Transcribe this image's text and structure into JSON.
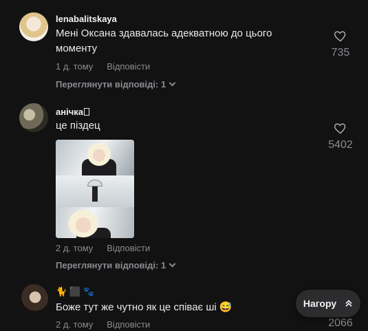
{
  "comments": [
    {
      "username": "lenabalitskaya",
      "text": "Мені Оксана здавалась адекватною до цього моменту",
      "time": "1 д. тому",
      "reply": "Відповісти",
      "likes": "735",
      "view_replies": "Переглянути відповіді: 1"
    },
    {
      "username": "анічка",
      "username_suffix": "",
      "text": "це піздец",
      "time": "2 д. тому",
      "reply": "Відповісти",
      "likes": "5402",
      "view_replies": "Переглянути відповіді: 1"
    },
    {
      "username_emojis": "🐈 ⬛ 🐾",
      "text": "Боже тут же чутно як це співає ші 😅",
      "time": "2 д. тому",
      "reply": "Відповісти",
      "likes": "2066"
    }
  ],
  "top_button": {
    "label": "Нагору"
  }
}
